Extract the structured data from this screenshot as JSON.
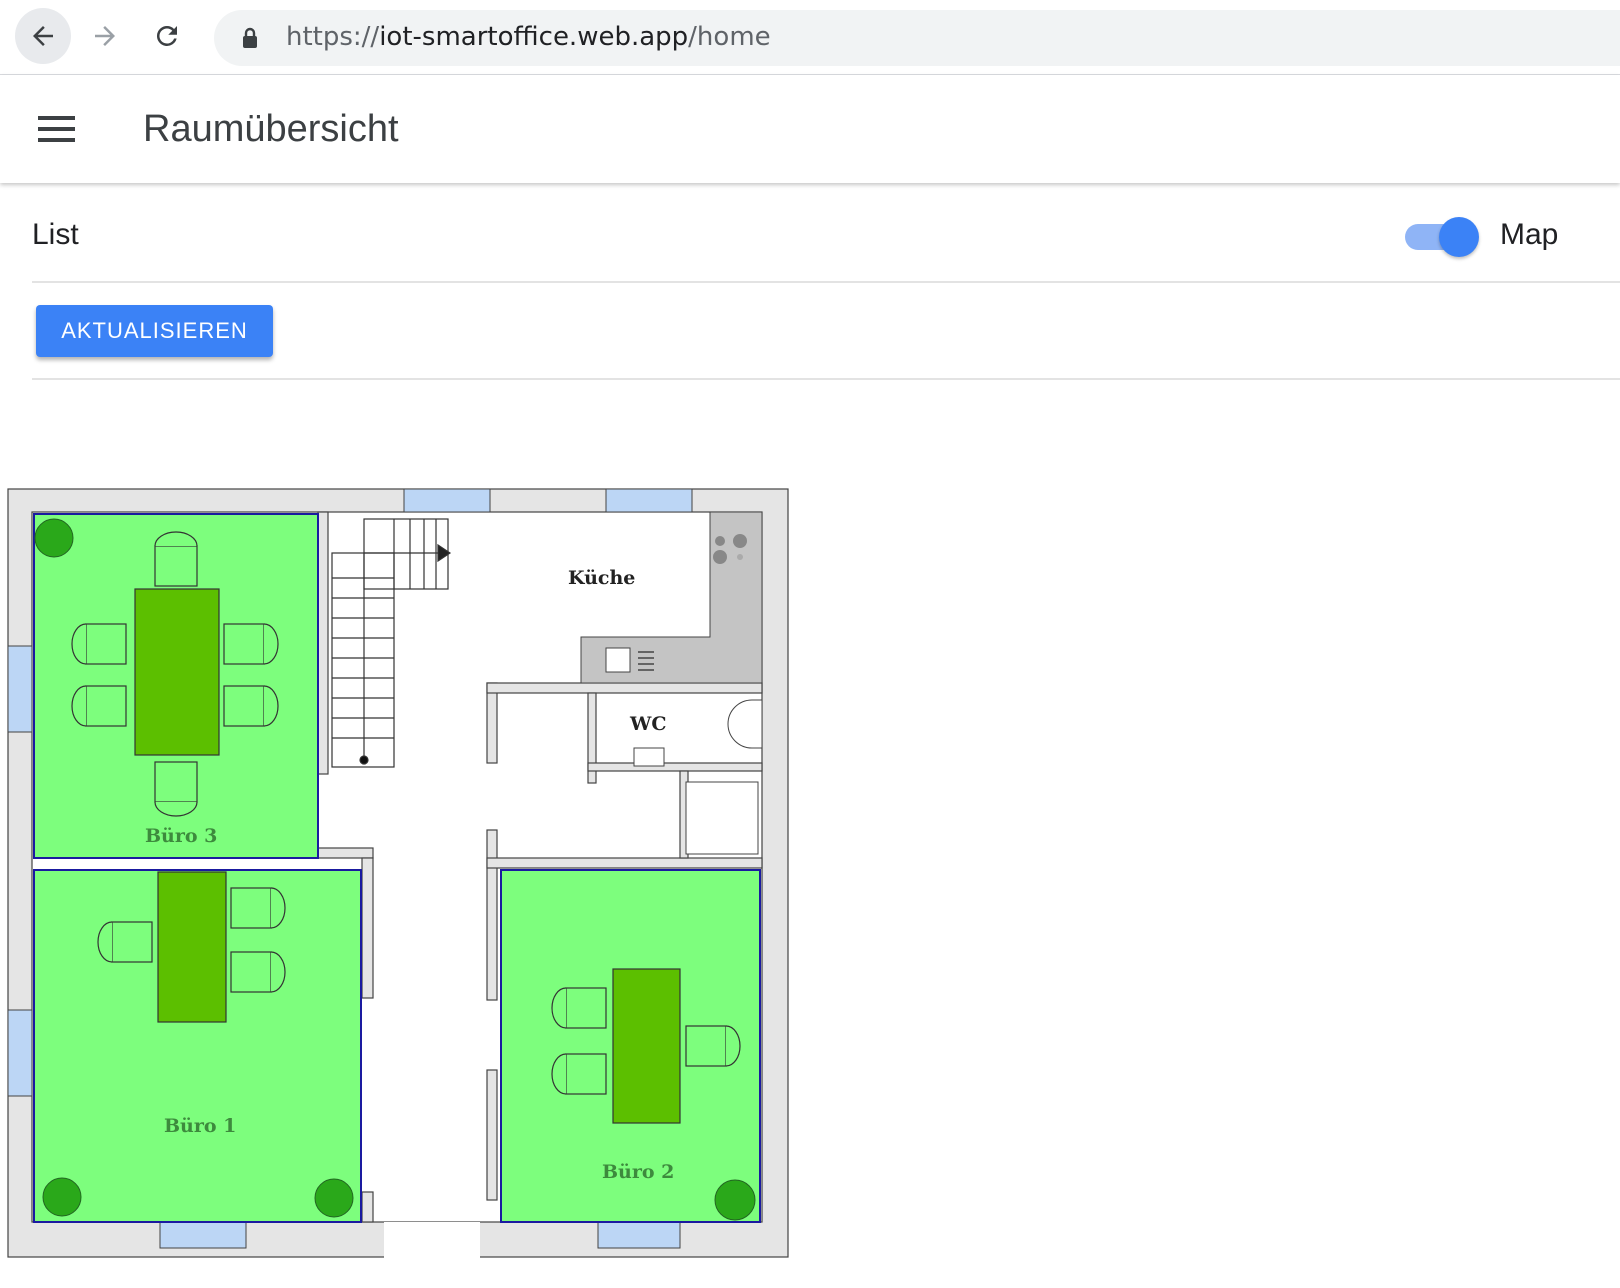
{
  "browser": {
    "url_scheme": "https://",
    "url_host": "iot-smartoffice.web.app",
    "url_path": "/home"
  },
  "appbar": {
    "title": "Raumübersicht",
    "menu_icon": "hamburger-menu-icon"
  },
  "view_toggle": {
    "left_label": "List",
    "right_label": "Map",
    "checked": true,
    "accent_color": "#3b82f6"
  },
  "actions": {
    "refresh_label": "AKTUALISIEREN"
  },
  "floorplan": {
    "rooms": {
      "buero3": {
        "label": "Büro 3",
        "status_color": "#7dfe7d"
      },
      "buero1": {
        "label": "Büro 1",
        "status_color": "#7dfe7d"
      },
      "buero2": {
        "label": "Büro 2",
        "status_color": "#7dfe7d"
      },
      "kueche": {
        "label": "Küche"
      },
      "wc": {
        "label": "WC"
      }
    },
    "colors": {
      "room_fill": "#7dfe7d",
      "furniture": "#5cbf00",
      "plant": "#2aa81a",
      "wall": "#e5e5e5",
      "window": "#bcd6f5"
    }
  }
}
